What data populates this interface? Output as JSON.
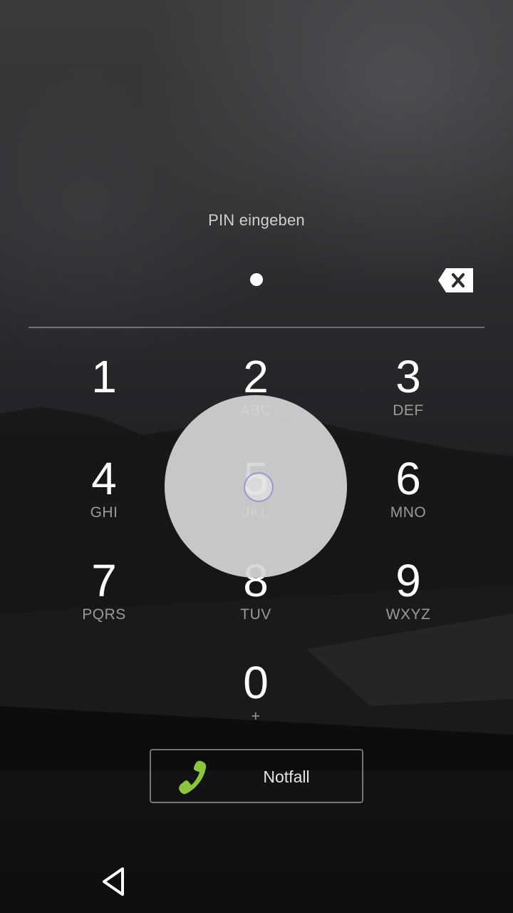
{
  "lockscreen": {
    "prompt": "PIN eingeben",
    "entered_digits": 1
  },
  "keypad": [
    {
      "digit": "1",
      "letters": ""
    },
    {
      "digit": "2",
      "letters": "ABC"
    },
    {
      "digit": "3",
      "letters": "DEF"
    },
    {
      "digit": "4",
      "letters": "GHI"
    },
    {
      "digit": "5",
      "letters": "JKL"
    },
    {
      "digit": "6",
      "letters": "MNO"
    },
    {
      "digit": "7",
      "letters": "PQRS"
    },
    {
      "digit": "8",
      "letters": "TUV"
    },
    {
      "digit": "9",
      "letters": "WXYZ"
    },
    {
      "digit": "0",
      "letters": "+"
    }
  ],
  "emergency": {
    "label": "Notfall",
    "icon": "phone-icon",
    "icon_color": "#8bc53f"
  },
  "icons": {
    "delete": "backspace-icon",
    "back": "back-triangle-icon"
  },
  "colors": {
    "text_primary": "#ffffff",
    "text_secondary": "#9a9a9a",
    "ripple": "#d4d5d6"
  }
}
